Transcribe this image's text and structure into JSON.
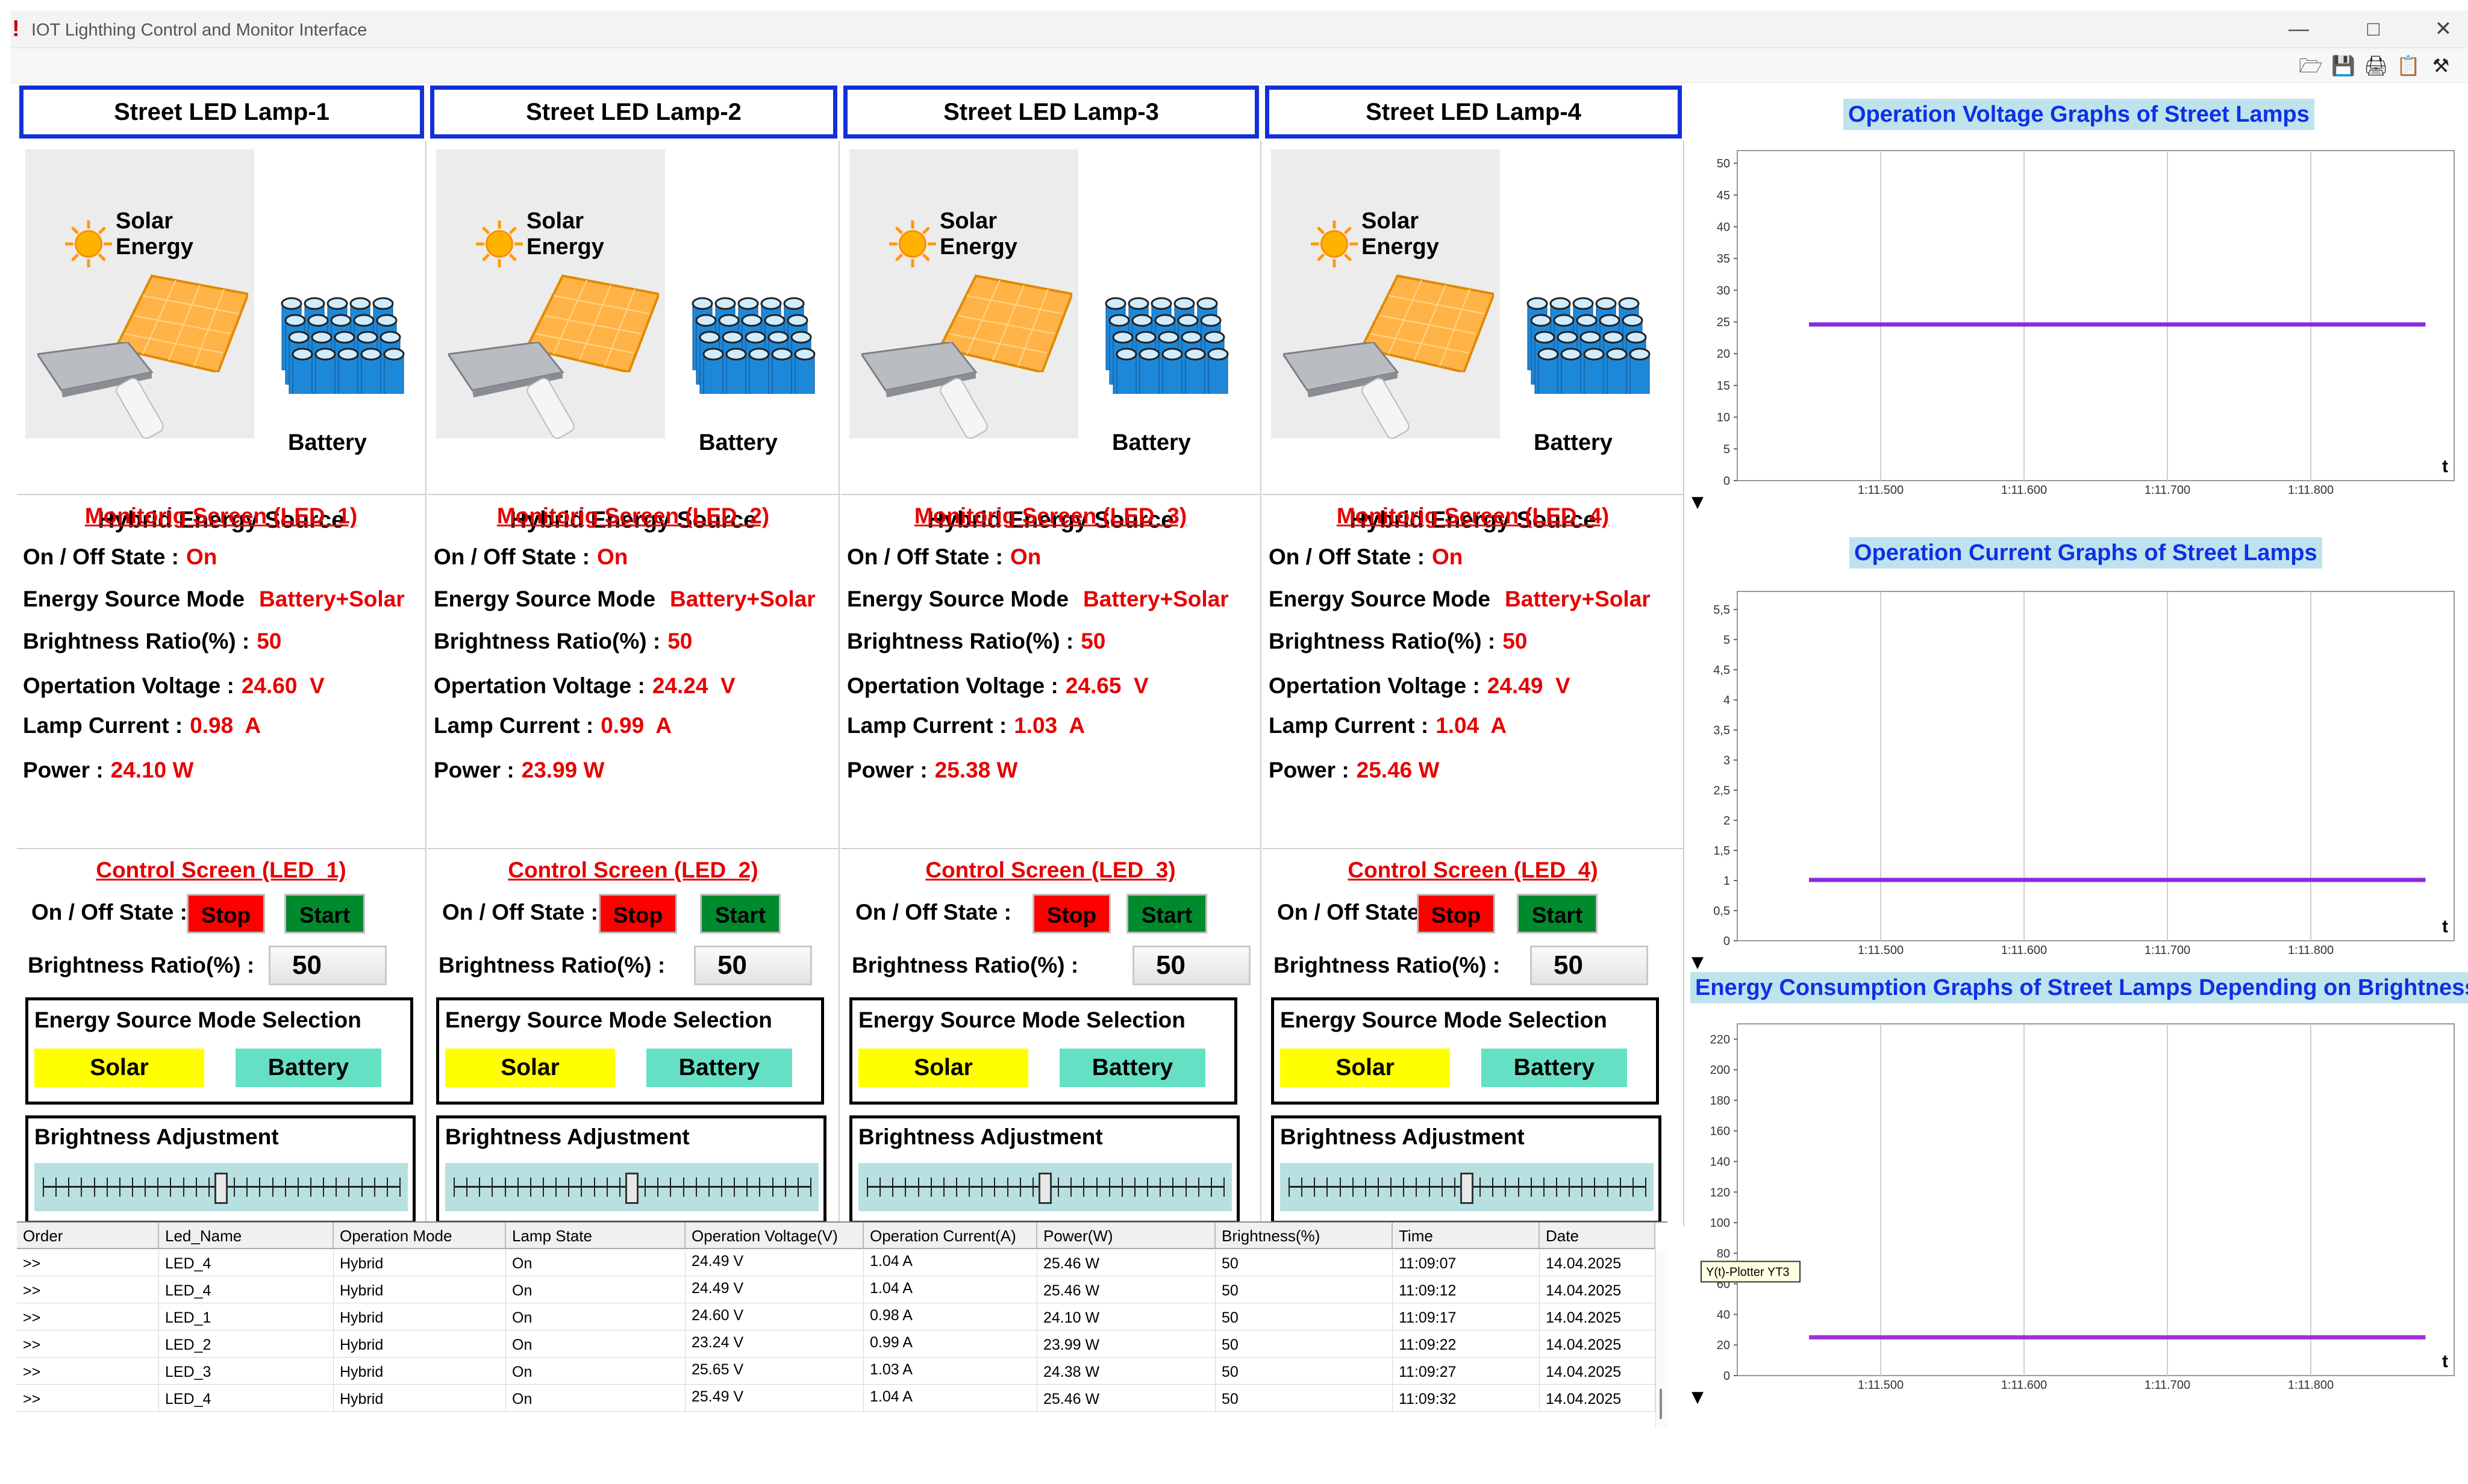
{
  "window": {
    "title": "IOT Lighthing Control and Monitor Interface",
    "controls": [
      "minimize-icon",
      "maximize-icon",
      "close-icon"
    ],
    "toolbar_icons": [
      "open-folder-icon",
      "save-icon",
      "print-icon",
      "clipboard-icon",
      "tools-icon"
    ]
  },
  "lamps": [
    {
      "title": "Street LED Lamp-1",
      "img_labels": {
        "solar": "Solar Energy",
        "battery": "Battery",
        "hybrid": "Hybrid Energy Source"
      },
      "monitor": {
        "title": "Monitorig Screen (LED_1)",
        "on_off_label": "On / Off State :",
        "on_off": "On",
        "mode_label": "Energy Source Mode",
        "mode": "Battery+Solar",
        "brightness_label": "Brightness Ratio(%) :",
        "brightness": "50",
        "voltage_label": "Opertation Voltage :",
        "voltage": "24.60  V",
        "current_label": "Lamp Current :",
        "current": "0.98  A",
        "power_label": "Power :",
        "power": "24.10 W"
      },
      "control": {
        "title": "Control Screen (LED_1)",
        "on_off_label": "On / Off State :",
        "stop": "Stop",
        "start": "Start",
        "brightness_label": "Brightness Ratio(%) :",
        "brightness_value": "50",
        "esm_title": "Energy Source Mode Selection",
        "solar": "Solar",
        "battery": "Battery",
        "adj_title": "Brightness Adjustment",
        "slider_fraction": 0.5
      }
    },
    {
      "title": "Street LED Lamp-2",
      "img_labels": {
        "solar": "Solar Energy",
        "battery": "Battery",
        "hybrid": "Hybrid Energy Source"
      },
      "monitor": {
        "title": "Monitorig Screen (LED_2)",
        "on_off_label": "On / Off State :",
        "on_off": "On",
        "mode_label": "Energy Source Mode",
        "mode": "Battery+Solar",
        "brightness_label": "Brightness Ratio(%) :",
        "brightness": "50",
        "voltage_label": "Opertation Voltage :",
        "voltage": "24.24  V",
        "current_label": "Lamp Current :",
        "current": "0.99  A",
        "power_label": "Power :",
        "power": "23.99 W"
      },
      "control": {
        "title": "Control Screen (LED_2)",
        "on_off_label": "On / Off State :",
        "stop": "Stop",
        "start": "Start",
        "brightness_label": "Brightness Ratio(%) :",
        "brightness_value": "50",
        "esm_title": "Energy Source Mode Selection",
        "solar": "Solar",
        "battery": "Battery",
        "adj_title": "Brightness Adjustment",
        "slider_fraction": 0.5
      }
    },
    {
      "title": "Street LED Lamp-3",
      "img_labels": {
        "solar": "Solar Energy",
        "battery": "Battery",
        "hybrid": "Hybrid Energy Source"
      },
      "monitor": {
        "title": "Monitorig Screen (LED_3)",
        "on_off_label": "On / Off State :",
        "on_off": "On",
        "mode_label": "Energy Source Mode",
        "mode": "Battery+Solar",
        "brightness_label": "Brightness Ratio(%) :",
        "brightness": "50",
        "voltage_label": "Opertation Voltage :",
        "voltage": "24.65  V",
        "current_label": "Lamp Current :",
        "current": "1.03  A",
        "power_label": "Power :",
        "power": "25.38 W"
      },
      "control": {
        "title": "Control Screen (LED_3)",
        "on_off_label": "On / Off State :",
        "stop": "Stop",
        "start": "Start",
        "brightness_label": "Brightness Ratio(%) :",
        "brightness_value": "50",
        "esm_title": "Energy Source Mode Selection",
        "solar": "Solar",
        "battery": "Battery",
        "adj_title": "Brightness Adjustment",
        "slider_fraction": 0.5
      }
    },
    {
      "title": "Street LED Lamp-4",
      "img_labels": {
        "solar": "Solar Energy",
        "battery": "Battery",
        "hybrid": "Hybrid Energy Source"
      },
      "monitor": {
        "title": "Monitorig Screen (LED_4)",
        "on_off_label": "On / Off State :",
        "on_off": "On",
        "mode_label": "Energy Source Mode",
        "mode": "Battery+Solar",
        "brightness_label": "Brightness Ratio(%) :",
        "brightness": "50",
        "voltage_label": "Opertation Voltage :",
        "voltage": "24.49  V",
        "current_label": "Lamp Current :",
        "current": "1.04  A",
        "power_label": "Power :",
        "power": "25.46 W"
      },
      "control": {
        "title": "Control Screen (LED_4)",
        "on_off_label": "On / Off State :",
        "stop": "Stop",
        "start": "Start",
        "brightness_label": "Brightness Ratio(%) :",
        "brightness_value": "50",
        "esm_title": "Energy Source Mode Selection",
        "solar": "Solar",
        "battery": "Battery",
        "adj_title": "Brightness Adjustment",
        "slider_fraction": 0.5
      }
    }
  ],
  "table": {
    "columns": [
      "Order",
      "Led_Name",
      "Operation Mode",
      "Lamp State",
      "Operation Voltage(V)",
      "Operation Current(A)",
      "Power(W)",
      "Brightness(%)",
      "Time",
      "Date"
    ],
    "rows": [
      [
        ">>",
        "LED_4",
        "Hybrid",
        "On",
        "24.49 V",
        "1.04 A",
        "25.46 W",
        "50",
        "11:09:07",
        "14.04.2025"
      ],
      [
        ">>",
        "LED_4",
        "Hybrid",
        "On",
        "24.49 V",
        "1.04 A",
        "25.46 W",
        "50",
        "11:09:12",
        "14.04.2025"
      ],
      [
        ">>",
        "LED_1",
        "Hybrid",
        "On",
        "24.60 V",
        "0.98 A",
        "24.10 W",
        "50",
        "11:09:17",
        "14.04.2025"
      ],
      [
        ">>",
        "LED_2",
        "Hybrid",
        "On",
        "23.24 V",
        "0.99 A",
        "23.99 W",
        "50",
        "11:09:22",
        "14.04.2025"
      ],
      [
        ">>",
        "LED_3",
        "Hybrid",
        "On",
        "25.65 V",
        "1.03 A",
        "24.38 W",
        "50",
        "11:09:27",
        "14.04.2025"
      ],
      [
        ">>",
        "LED_4",
        "Hybrid",
        "On",
        "25.49 V",
        "1.04 A",
        "25.46 W",
        "50",
        "11:09:32",
        "14.04.2025"
      ]
    ]
  },
  "chart_data": [
    {
      "type": "line",
      "title": "Operation Voltage Graphs of Street Lamps",
      "xlabel": "t",
      "x_ticks": [
        "1:11.500",
        "1:11.600",
        "1:11.700",
        "1:11.800"
      ],
      "y_ticks": [
        "0",
        "5",
        "10",
        "15",
        "20",
        "25",
        "30",
        "35",
        "40",
        "45",
        "50"
      ],
      "ylim": [
        0,
        52
      ],
      "grid": true,
      "series": [
        {
          "color": "#8a2be2",
          "x": [
            1.45,
            1.88
          ],
          "values": [
            24.6,
            24.6
          ]
        }
      ],
      "colors": {
        "series": "#8a2be2"
      }
    },
    {
      "type": "line",
      "title": "Operation Current Graphs of Street Lamps",
      "xlabel": "t",
      "x_ticks": [
        "1:11.500",
        "1:11.600",
        "1:11.700",
        "1:11.800"
      ],
      "y_ticks": [
        "0",
        "0,5",
        "1",
        "1,5",
        "2",
        "2,5",
        "3",
        "3,5",
        "4",
        "4,5",
        "5",
        "5,5"
      ],
      "ylim": [
        0,
        5.8
      ],
      "grid": true,
      "series": [
        {
          "color": "#8a2be2",
          "x": [
            1.45,
            1.88
          ],
          "values": [
            1.01,
            1.01
          ]
        }
      ],
      "colors": {
        "series": "#8a2be2"
      }
    },
    {
      "type": "line",
      "title": "Energy Consumption Graphs of Street Lamps Depending on Brightness",
      "xlabel": "t",
      "x_ticks": [
        "1:11.500",
        "1:11.600",
        "1:11.700",
        "1:11.800"
      ],
      "y_ticks": [
        "0",
        "20",
        "40",
        "60",
        "80",
        "100",
        "120",
        "140",
        "160",
        "180",
        "200",
        "220"
      ],
      "ylim": [
        0,
        230
      ],
      "grid": true,
      "tooltip": "Y(t)-Plotter YT3",
      "series": [
        {
          "color": "#a033d6",
          "x": [
            1.45,
            1.88
          ],
          "values": [
            25,
            25
          ]
        }
      ],
      "colors": {
        "series": "#a033d6"
      }
    }
  ]
}
